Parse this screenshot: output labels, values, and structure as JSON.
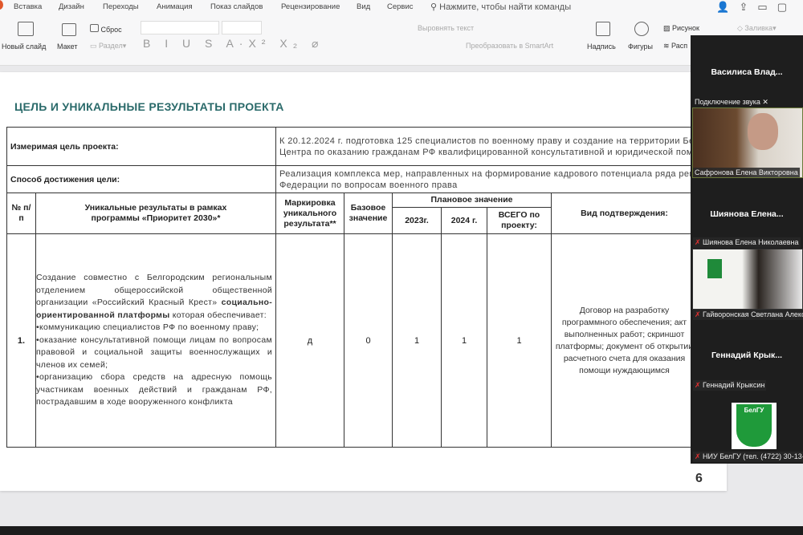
{
  "ribbon": {
    "tabs": [
      "Вставка",
      "Дизайн",
      "Переходы",
      "Анимация",
      "Показ слайдов",
      "Рецензирование",
      "Вид",
      "Сервис"
    ],
    "search": "Нажмите, чтобы найти команды",
    "new_slide": "Новый слайд",
    "layout": "Макет",
    "reset": "Сброс",
    "section": "Раздел",
    "align_text": "Выровнять текст",
    "smartart": "Преобразовать в SmartArt",
    "textbox": "Надпись",
    "shapes": "Фигуры",
    "picture": "Рисунок",
    "fill": "Заливка",
    "arrange": "Расп"
  },
  "slide": {
    "title": "ЦЕЛЬ И УНИКАЛЬНЫЕ РЕЗУЛЬТАТЫ ПРОЕКТА",
    "goal_label": "Измеримая цель проекта:",
    "goal_line1": "К 20.12.2024 г. подготовка 125 специалистов по военному праву и создание на территории Белгородской обла",
    "goal_line2": "Центра по оказанию гражданам РФ квалифицированной консультативной и юридической помощи",
    "method_label": "Способ достижения цели:",
    "method_line1": "Реализация комплекса мер, направленных на формирование кадрового потенциала ряда регионов Российс",
    "method_line2": "Федерации по вопросам военного права",
    "headers": {
      "num": "№ п/п",
      "results": "Уникальные результаты в рамках программы «Приоритет 2030»*",
      "marking": "Маркировка уникального результата**",
      "base": "Базовое значение",
      "planned": "Плановое значение",
      "y2023": "2023г.",
      "y2024": "2024 г.",
      "total": "ВСЕГО по проекту:",
      "confirm": "Вид подтверждения:"
    },
    "row": {
      "num": "1.",
      "desc_intro": "Создание совместно с Белгородским региональным отделением общероссийской общественной организации «Российский Красный Крест» ",
      "desc_bold": "социально-ориентированной платформы",
      "desc_rest": " которая обеспечивает:",
      "bullets": [
        "•коммуникацию специалистов РФ по военному праву;",
        "•оказание консультативной помощи лицам по вопросам правовой и социальной защиты военнослужащих и членов их семей;",
        "•организацию сбора средств на адресную помощь участникам военных действий и гражданам РФ, пострадавшим в ходе вооруженного конфликта"
      ],
      "marking": "д",
      "base": "0",
      "y2023": "1",
      "y2024": "1",
      "total": "1",
      "confirm": "Договор на разработку программного обеспечения; акт выполненных работ; скриншот платформы; документ об открытии расчетного счета для оказания помощи нуждающимся"
    },
    "page_number": "6"
  },
  "participants": [
    {
      "tile": "Василиса  Влад..."
    },
    {
      "label": "Подключение звука ✕"
    },
    {
      "label": "Сафронова Елена Викторовна"
    },
    {
      "tile": "Шиянова  Елена...",
      "label": "Шиянова Елена Николаевна"
    },
    {
      "label": "Гайворонская Светлана Алекс"
    },
    {
      "tile": "Геннадий  Крык...",
      "label": "Геннадий Крыксин"
    },
    {
      "label": "НИУ БелГУ (тел. (4722) 30-13-"
    }
  ],
  "logo_text": "БелГУ"
}
